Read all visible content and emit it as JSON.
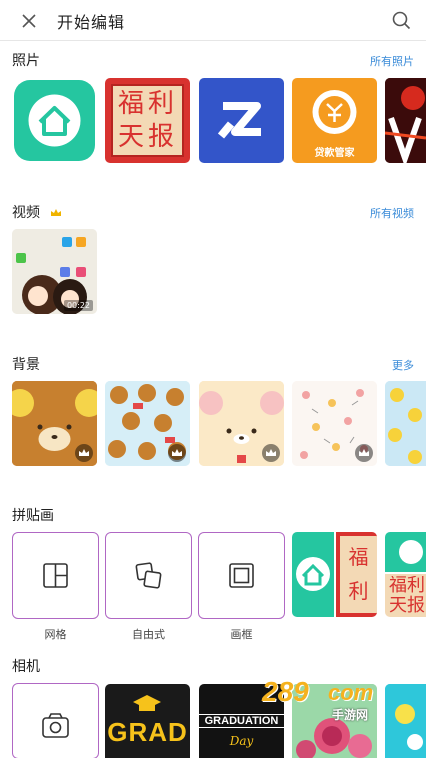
{
  "header": {
    "title": "开始编辑"
  },
  "sections": {
    "photos": {
      "title": "照片",
      "link": "所有照片"
    },
    "videos": {
      "title": "视频",
      "link": "所有视频",
      "duration": "00:22"
    },
    "backgrounds": {
      "title": "背景",
      "link": "更多"
    },
    "collage": {
      "title": "拼贴画",
      "items": [
        {
          "label": "网格"
        },
        {
          "label": "自由式"
        },
        {
          "label": "画框"
        }
      ]
    },
    "camera": {
      "title": "相机"
    }
  },
  "photo_text": {
    "fuli": "福利天报",
    "loan": "贷款管家"
  },
  "camera_text": {
    "grad": "GRAD",
    "graduation": "GRADUATION",
    "day": "Day"
  },
  "watermark": {
    "brand": "289",
    "suffix": "com",
    "sub": "手游网"
  },
  "colors": {
    "accent_link": "#3a8bd8",
    "frame_border": "#b067c4",
    "crown_gold": "#f0b400"
  }
}
